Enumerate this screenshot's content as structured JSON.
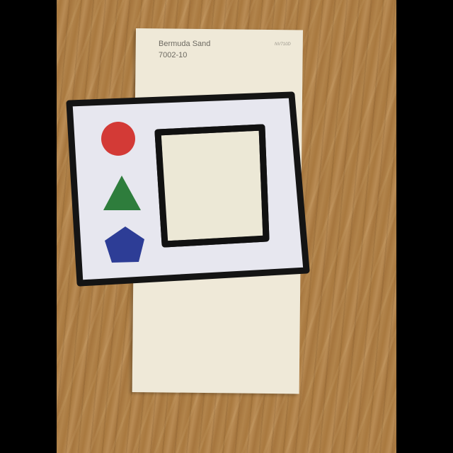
{
  "swatch": {
    "name": "Bermuda Sand",
    "code": "7002-10",
    "id": "NV710D"
  },
  "shapes": [
    {
      "kind": "circle",
      "color": "#d33a36"
    },
    {
      "kind": "triangle",
      "color": "#2e7d3c"
    },
    {
      "kind": "pentagon",
      "color": "#2d3d96"
    }
  ]
}
